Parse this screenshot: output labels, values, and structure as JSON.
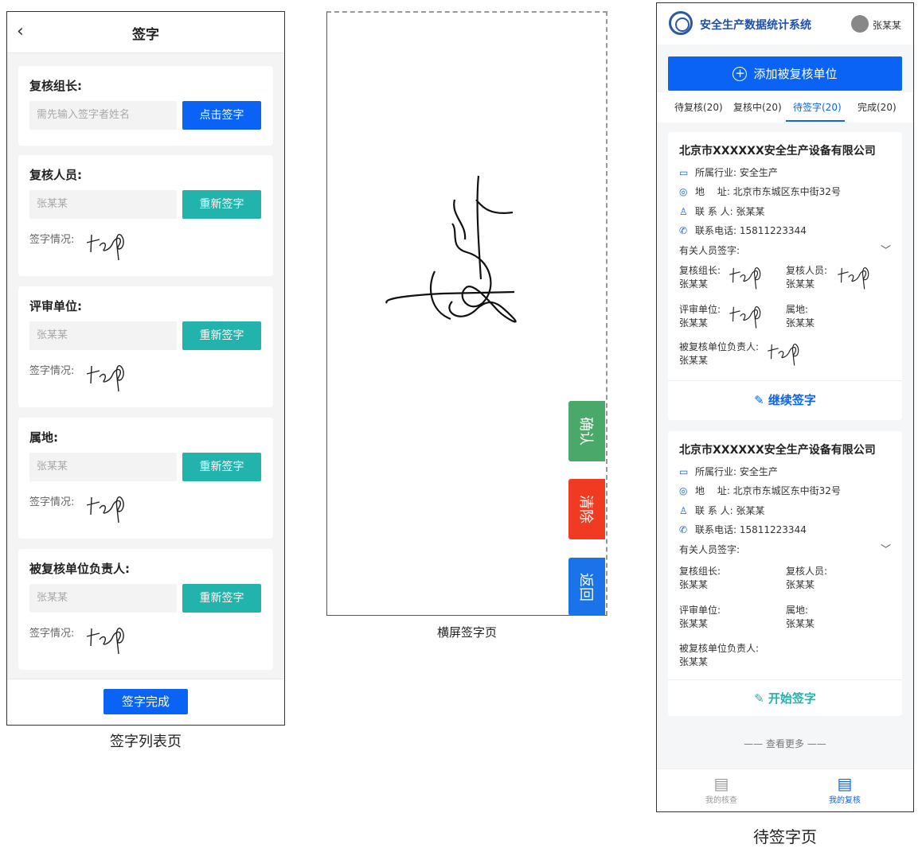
{
  "panel1": {
    "back_icon": "‹",
    "title": "签字",
    "cards": [
      {
        "label": "复核组长:",
        "input": "需先输入签字者姓名",
        "button": "点击签字",
        "button_color": "#0a63f5"
      },
      {
        "label": "复核人员:",
        "input": "张某某",
        "button": "重新签字",
        "button_color": "#21b3ac",
        "status": "签字情况:"
      },
      {
        "label": "评审单位:",
        "input": "张某某",
        "button": "重新签字",
        "button_color": "#21b3ac",
        "status": "签字情况:"
      },
      {
        "label": "属地:",
        "input": "张某某",
        "button": "重新签字",
        "button_color": "#21b3ac",
        "status": "签字情况:"
      },
      {
        "label": "被复核单位负责人:",
        "input": "张某某",
        "button": "重新签字",
        "button_color": "#21b3ac",
        "status": "签字情况:"
      }
    ],
    "done_button": "签字完成",
    "caption": "签字列表页"
  },
  "panel2": {
    "buttons": [
      {
        "label": "确认",
        "color": "#4aa86a"
      },
      {
        "label": "清除",
        "color": "#f03a22"
      },
      {
        "label": "返回",
        "color": "#1a73e8"
      }
    ],
    "caption": "横屏签字页"
  },
  "panel3": {
    "app_title": "安全生产数据统计系统",
    "user_name": "张某某",
    "add_button": "添加被复核单位",
    "tabs": [
      {
        "label": "待复核(20)",
        "active": false
      },
      {
        "label": "复核中(20)",
        "active": false
      },
      {
        "label": "待签字(20)",
        "active": true
      },
      {
        "label": "完成(20)",
        "active": false
      }
    ],
    "records": [
      {
        "company": "北京市XXXXXX安全生产设备有限公司",
        "industry": "所属行业: 安全生产",
        "address": "地　 址: 北京市东城区东中街32号",
        "contact": "联 系 人: 张某某",
        "phone": "联系电话: 15811223344",
        "signers_title": "有关人员签字:",
        "signers": [
          {
            "role": "复核组长:",
            "name": "张某某"
          },
          {
            "role": "复核人员:",
            "name": "张某某"
          },
          {
            "role": "评审单位:",
            "name": "张某某"
          },
          {
            "role": "属地:",
            "name": "张某某"
          },
          {
            "role": "被复核单位负责人:",
            "name": "张某某"
          }
        ],
        "action": "继续签字"
      },
      {
        "company": "北京市XXXXXX安全生产设备有限公司",
        "industry": "所属行业: 安全生产",
        "address": "地　 址: 北京市东城区东中街32号",
        "contact": "联 系 人: 张某某",
        "phone": "联系电话: 15811223344",
        "signers_title": "有关人员签字:",
        "signers": [
          {
            "role": "复核组长:",
            "name": "张某某"
          },
          {
            "role": "复核人员:",
            "name": "张某某"
          },
          {
            "role": "评审单位:",
            "name": "张某某"
          },
          {
            "role": "属地:",
            "name": "张某某"
          },
          {
            "role": "被复核单位负责人:",
            "name": "张某某"
          }
        ],
        "action": "开始签字"
      }
    ],
    "more": "—— 查看更多 ——",
    "nav": [
      {
        "label": "我的核查",
        "active": false
      },
      {
        "label": "我的复核",
        "active": true
      }
    ],
    "caption": "待签字页"
  }
}
